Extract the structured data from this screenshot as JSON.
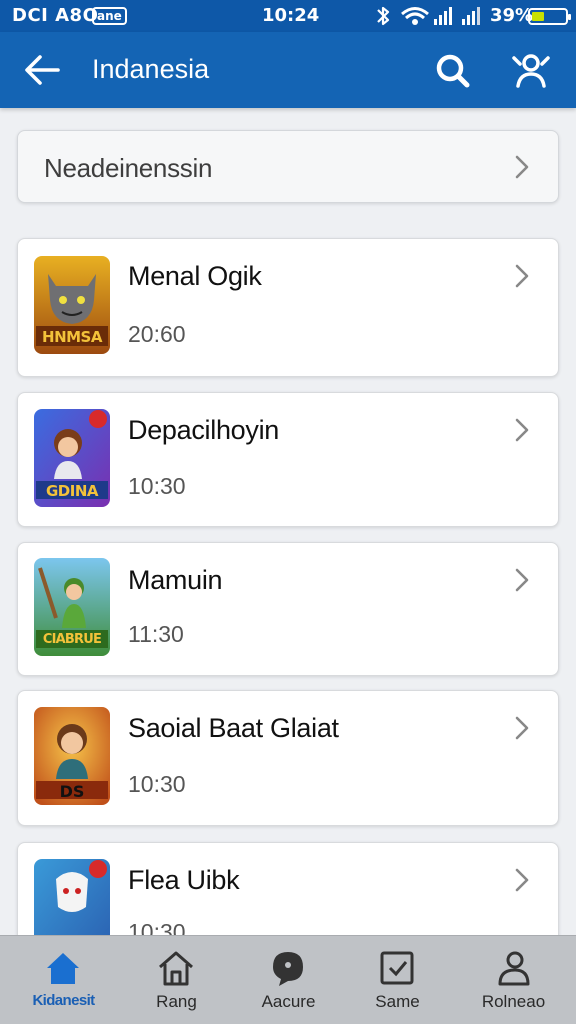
{
  "status_bar": {
    "left_text": "DCI A8O",
    "chip": "ane",
    "time": "10:24",
    "battery": "39%"
  },
  "app_bar": {
    "title": "Indanesia",
    "back_icon": "arrow-left-icon",
    "search_icon": "search-icon",
    "people_icon": "people-icon"
  },
  "header_card": {
    "label": "Neadeinenssin"
  },
  "items": [
    {
      "title": "Menal Ogik",
      "time": "20:60",
      "badge": "HNMSA"
    },
    {
      "title": "Depacilhoyin",
      "time": "10:30",
      "badge": "GDINA"
    },
    {
      "title": "Mamuin",
      "time": "11:30",
      "badge": "CIABRUE"
    },
    {
      "title": "Saoial Baat Glaiat",
      "time": "10:30",
      "badge": "DS"
    },
    {
      "title": "Flea Uibk",
      "time": "10:30",
      "badge": ""
    }
  ],
  "bottom_nav": [
    {
      "label": "Kidanesit",
      "icon": "home-icon",
      "active": true
    },
    {
      "label": "Rang",
      "icon": "house-outline-icon",
      "active": false
    },
    {
      "label": "Aacure",
      "icon": "chat-bubble-icon",
      "active": false
    },
    {
      "label": "Same",
      "icon": "tag-icon",
      "active": false
    },
    {
      "label": "Rolneao",
      "icon": "person-icon",
      "active": false
    }
  ],
  "colors": {
    "primary": "#1464b4",
    "status_bar": "#0e58a8",
    "background": "#eef0f3",
    "active_nav": "#1a5fb4"
  }
}
